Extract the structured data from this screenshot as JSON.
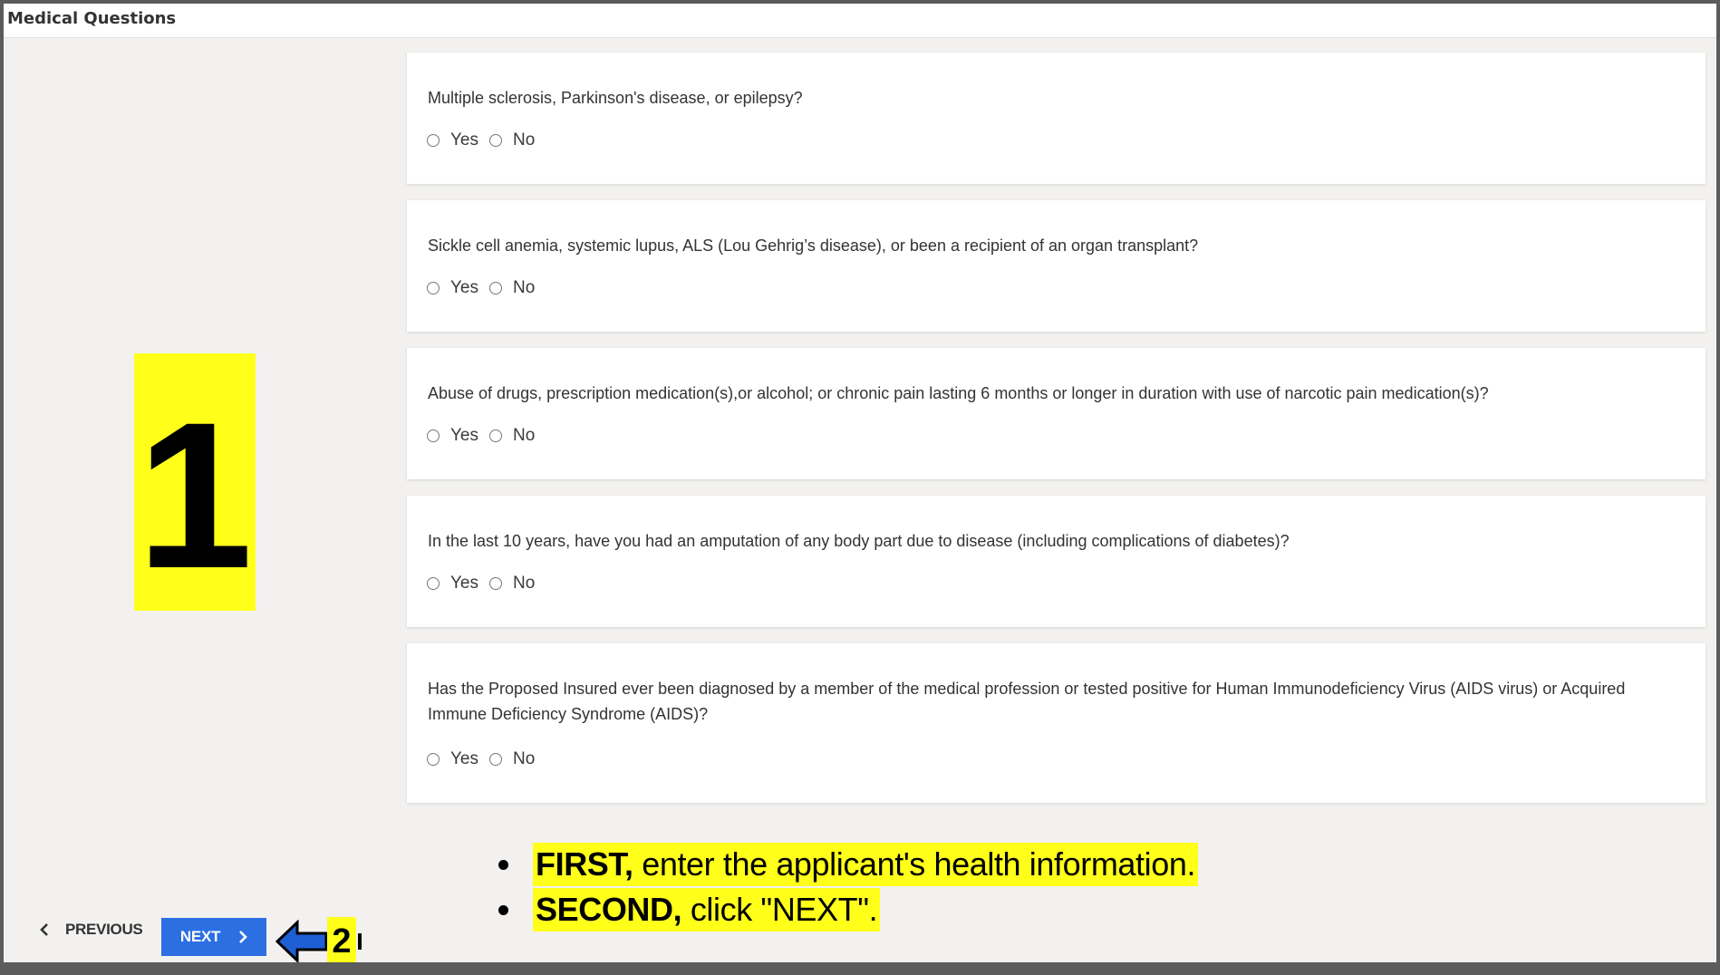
{
  "page_title": "Medical Questions",
  "questions": [
    {
      "text": "Multiple sclerosis, Parkinson's disease, or epilepsy?",
      "options": [
        "Yes",
        "No"
      ]
    },
    {
      "text": "Sickle cell anemia, systemic lupus, ALS (Lou Gehrig’s disease), or been a recipient of an organ transplant?",
      "options": [
        "Yes",
        "No"
      ]
    },
    {
      "text": "Abuse of drugs, prescription medication(s),or alcohol; or chronic pain lasting 6 months or longer in duration with use of narcotic pain medication(s)?",
      "options": [
        "Yes",
        "No"
      ]
    },
    {
      "text": "In the last 10 years, have you had an amputation of any body part due to disease (including complications of diabetes)?",
      "options": [
        "Yes",
        "No"
      ]
    },
    {
      "text": "Has the Proposed Insured ever been diagnosed by a member of the medical profession or tested positive for Human Immunodeficiency Virus (AIDS virus) or Acquired Immune Deficiency Syndrome (AIDS)?",
      "options": [
        "Yes",
        "No"
      ]
    }
  ],
  "annotation": {
    "step1_number": "1",
    "step2_number": "2",
    "bullets": [
      {
        "bold": "FIRST,",
        "rest": " enter the applicant's health information."
      },
      {
        "bold": "SECOND,",
        "rest": " click \"NEXT\"."
      }
    ],
    "highlight_color": "#ffff1a"
  },
  "nav": {
    "previous_label": "PREVIOUS",
    "next_label": "NEXT"
  },
  "colors": {
    "next_button": "#2b6fe3",
    "arrow": "#1f5fd6"
  }
}
